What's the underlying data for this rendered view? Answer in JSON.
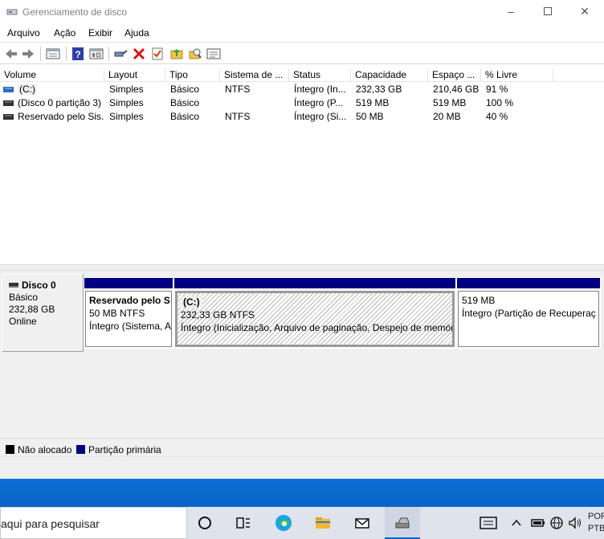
{
  "window": {
    "title": "Gerenciamento de disco"
  },
  "menu": [
    "Arquivo",
    "Ação",
    "Exibir",
    "Ajuda"
  ],
  "toolbar": {
    "buttons": [
      "back-icon",
      "forward-icon",
      "properties-view-icon",
      "help-icon",
      "console-view-icon",
      "connect-icon",
      "delete-icon",
      "check-icon",
      "folder-up-icon",
      "search-folder-icon",
      "list-view-icon"
    ]
  },
  "volume_list": {
    "columns": [
      "Volume",
      "Layout",
      "Tipo",
      "Sistema de ...",
      "Status",
      "Capacidade",
      "Espaço ...",
      "% Livre"
    ],
    "rows": [
      [
        "(C:)",
        "Simples",
        "Básico",
        "NTFS",
        "Íntegro (In...",
        "232,33 GB",
        "210,46 GB",
        "91 %"
      ],
      [
        "(Disco 0 partição 3)",
        "Simples",
        "Básico",
        "",
        "Íntegro (P...",
        "519 MB",
        "519 MB",
        "100 %"
      ],
      [
        "Reservado pelo Sis...",
        "Simples",
        "Básico",
        "NTFS",
        "Íntegro (Si...",
        "50 MB",
        "20 MB",
        "40 %"
      ]
    ]
  },
  "disk": {
    "name": "Disco 0",
    "type": "Básico",
    "size": "232,88 GB",
    "status": "Online",
    "partitions": [
      {
        "title": "Reservado pelo S",
        "size": "50 MB NTFS",
        "status": "Íntegro (Sistema, A"
      },
      {
        "title": "(C:)",
        "size": "232,33 GB NTFS",
        "status": "Íntegro (Inicialização, Arquivo de paginação, Despejo de memór"
      },
      {
        "title": "",
        "size": "519 MB",
        "status": "Íntegro (Partição de Recuperaç"
      }
    ]
  },
  "legend": [
    {
      "label": "Não alocado",
      "color": "#000000"
    },
    {
      "label": "Partição primária",
      "color": "#000080"
    }
  ],
  "taskbar": {
    "search_placeholder": "aqui para pesquisar",
    "apps": [
      "cortana-icon",
      "task-view-icon",
      "edge-icon",
      "file-explorer-icon",
      "mail-icon",
      "disk-management-icon"
    ],
    "tray": [
      "notification-icon",
      "chevron-up-icon",
      "battery-icon",
      "network-icon",
      "volume-icon"
    ],
    "language": [
      "POR",
      "PTB"
    ]
  },
  "colors": {
    "primary_partition": "#000080",
    "desktop": "#0a63c7",
    "taskbar": "#dfe3ec"
  }
}
